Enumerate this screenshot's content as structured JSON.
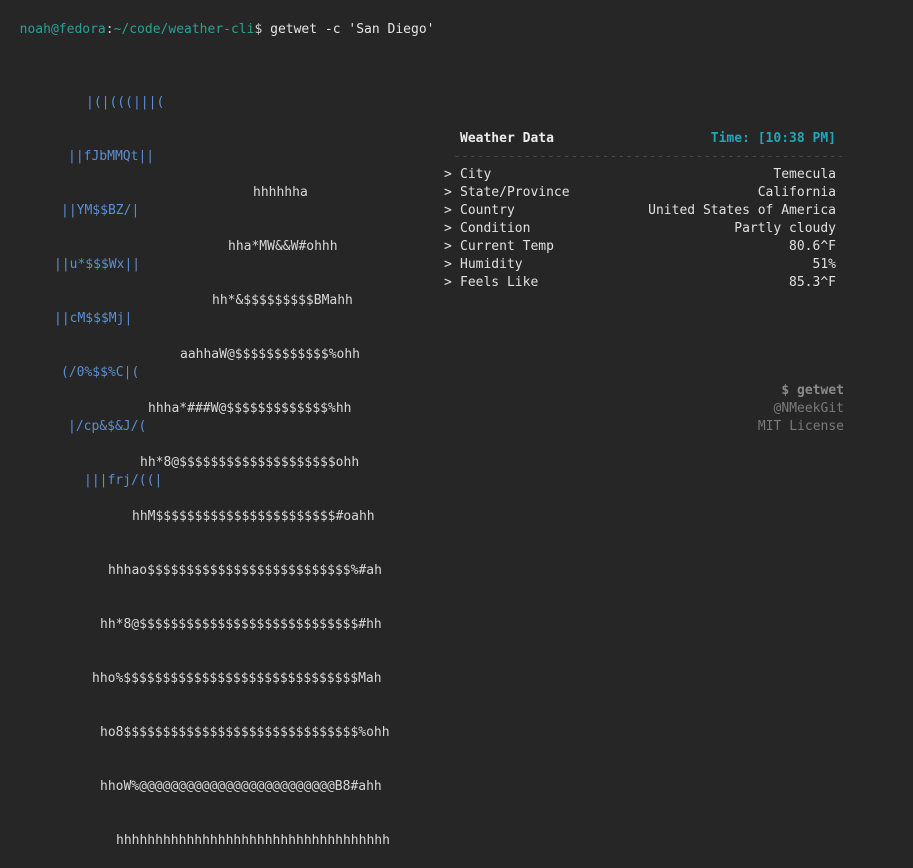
{
  "prompt": {
    "user_host": "noah@fedora",
    "sep1": ":",
    "path": "~/code/weather-cli",
    "sep2": "$ ",
    "command": "getwet -c 'San Diego'"
  },
  "ascii_cloud_lines": [
    "|(|(((|||(",
    "||fJbMMQt||",
    "||YM$$BZ/|",
    "||u*$$$Wx||",
    "||cM$$$Mj|",
    "(/0%$$%C|(",
    "|/cp&$&J/(",
    "|||frj/((|"
  ],
  "ascii_sun_lines": [
    "hhhhhha",
    "hha*MW&&W#ohhh",
    "hh*&$$$$$$$$$BMahh",
    "aahhaW@$$$$$$$$$$$$%ohh",
    "hhha*###W@$$$$$$$$$$$$$%hh",
    "hh*8@$$$$$$$$$$$$$$$$$$$$ohh",
    "hhM$$$$$$$$$$$$$$$$$$$$$$$#oahh",
    "hhhao$$$$$$$$$$$$$$$$$$$$$$$$$$%#ah",
    "hh*8@$$$$$$$$$$$$$$$$$$$$$$$$$$$$#hh",
    "hho%$$$$$$$$$$$$$$$$$$$$$$$$$$$$$$Mah",
    "ho8$$$$$$$$$$$$$$$$$$$$$$$$$$$$$$%ohh",
    "hhoW%@@@@@@@@@@@@@@@@@@@@@@@@@B8#ahh",
    "hhhhhhhhhhhhhhhhhhhhhhhhhhhhhhhhhhh"
  ],
  "panel": {
    "title": "Weather Data",
    "time": "Time: [10:38 PM]",
    "divider": "------------------------------------------------------",
    "rows": [
      {
        "marker": ">",
        "label": "City",
        "value": "Temecula"
      },
      {
        "marker": ">",
        "label": "State/Province",
        "value": "California"
      },
      {
        "marker": ">",
        "label": "Country",
        "value": "United States of America"
      },
      {
        "marker": ">",
        "label": "Condition",
        "value": "Partly cloudy"
      },
      {
        "marker": ">",
        "label": "Current Temp",
        "value": "80.6^F"
      },
      {
        "marker": ">",
        "label": "Humidity",
        "value": "51%"
      },
      {
        "marker": ">",
        "label": "Feels Like",
        "value": "85.3^F"
      }
    ]
  },
  "footer": {
    "command": "$ getwet",
    "author": "@NMeekGit",
    "license": "MIT License"
  },
  "colors": {
    "background": "#262626",
    "accent_teal": "#21a6b7",
    "cloud_blue": "#5b8fd1"
  }
}
